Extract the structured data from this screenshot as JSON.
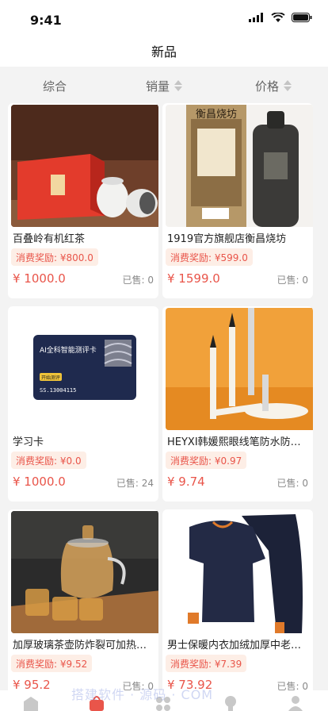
{
  "status": {
    "time": "9:41"
  },
  "nav": {
    "title": "新品"
  },
  "sort": {
    "items": [
      "综合",
      "销量",
      "价格"
    ]
  },
  "products": [
    {
      "title": "百叠岭有机红茶",
      "reward": "消费奖励: ¥800.0",
      "price": "¥ 1000.0",
      "sold": "已售: 0"
    },
    {
      "title": "1919官方旗舰店衡昌烧坊",
      "reward": "消费奖励: ¥599.0",
      "price": "¥ 1599.0",
      "sold": "已售: 0"
    },
    {
      "title": "学习卡",
      "reward": "消费奖励: ¥0.0",
      "price": "¥ 1000.0",
      "sold": "已售: 24"
    },
    {
      "title": "HEYXI韩媛熙眼线笔防水防汗…",
      "reward": "消费奖励: ¥0.97",
      "price": "¥ 9.74",
      "sold": "已售: 0"
    },
    {
      "title": "加厚玻璃茶壶防炸裂可加热茶…",
      "reward": "消费奖励: ¥9.52",
      "price": "¥ 95.2",
      "sold": "已售: 0"
    },
    {
      "title": "男士保暖内衣加绒加厚中老年…",
      "reward": "消费奖励: ¥7.39",
      "price": "¥ 73.92",
      "sold": "已售: 0"
    }
  ],
  "images": {
    "p1_label": "",
    "p2_label": "衡昌烧坊",
    "p3_card_title": "AI全科智能测评卡",
    "p3_card_number": "SS.13004115",
    "p3_card_btn": "开始测评"
  },
  "watermark": "搭建软件 · 源码 · COM",
  "colors": {
    "accent": "#e9554a",
    "reward_bg": "#fdeee6"
  }
}
